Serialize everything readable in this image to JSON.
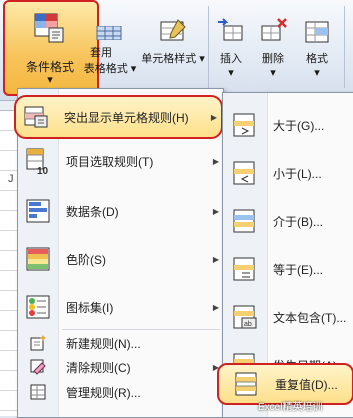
{
  "ribbon": {
    "conditional_format_label": "条件格式",
    "format_as_table_label_1": "套用",
    "format_as_table_label_2": "表格格式",
    "cell_styles_label": "单元格样式",
    "insert_label": "插入",
    "delete_label": "删除",
    "format_label": "格式",
    "dropdown_glyph": "▾"
  },
  "sheet": {
    "column_letter": "J"
  },
  "menu": {
    "items": [
      {
        "label": "突出显示单元格规则(H)",
        "icon": "highlight-cells-icon",
        "has_submenu": true,
        "selected": true
      },
      {
        "label": "项目选取规则(T)",
        "icon": "top-bottom-rules-icon",
        "has_submenu": true
      },
      {
        "label": "数据条(D)",
        "icon": "data-bars-icon",
        "has_submenu": true
      },
      {
        "label": "色阶(S)",
        "icon": "color-scales-icon",
        "has_submenu": true
      },
      {
        "label": "图标集(I)",
        "icon": "icon-sets-icon",
        "has_submenu": true
      },
      {
        "label": "新建规则(N)...",
        "icon": "new-rule-icon",
        "has_submenu": false
      },
      {
        "label": "清除规则(C)",
        "icon": "clear-rules-icon",
        "has_submenu": true
      },
      {
        "label": "管理规则(R)...",
        "icon": "manage-rules-icon",
        "has_submenu": false
      }
    ]
  },
  "submenu": {
    "items": [
      {
        "label": "大于(G)...",
        "icon": "greater-than-icon"
      },
      {
        "label": "小于(L)...",
        "icon": "less-than-icon"
      },
      {
        "label": "介于(B)...",
        "icon": "between-icon"
      },
      {
        "label": "等于(E)...",
        "icon": "equal-to-icon"
      },
      {
        "label": "文本包含(T)...",
        "icon": "text-contains-icon"
      },
      {
        "label": "发生日期(A)...",
        "icon": "date-occurring-icon"
      },
      {
        "label": "重复值(D)...",
        "icon": "duplicate-values-icon",
        "selected": true
      }
    ]
  },
  "watermark": "Excel精英培训",
  "colors": {
    "highlight_border": "#d02020",
    "selection_fill": "#fde08a"
  }
}
